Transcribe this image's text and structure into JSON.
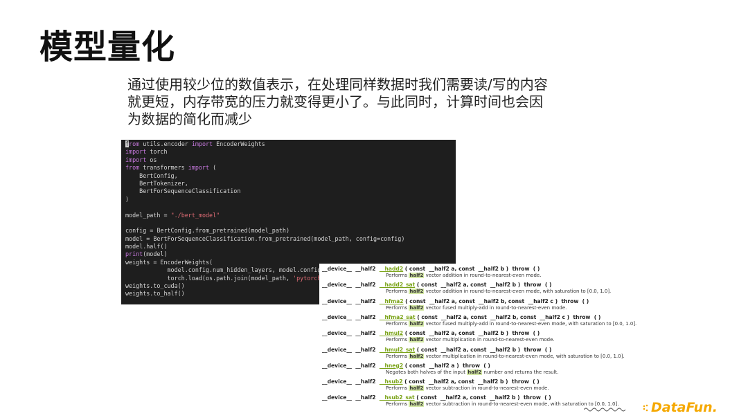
{
  "slide": {
    "title": "模型量化",
    "description_lines": [
      "通过使用较少位的数值表示，在处理同样数据时我们需要读/写的内容",
      "就更短，内存带宽的压力就变得更小了。与此同时，计算时间也会因",
      "为数据的简化而减少"
    ]
  },
  "code": [
    [
      [
        "cursor",
        "f"
      ],
      [
        "kw",
        "rom"
      ],
      [
        "t",
        " utils.encoder "
      ],
      [
        "kw",
        "import"
      ],
      [
        "t",
        " EncoderWeights"
      ]
    ],
    [
      [
        "kw",
        "import"
      ],
      [
        "t",
        " torch"
      ]
    ],
    [
      [
        "kw",
        "import"
      ],
      [
        "t",
        " os"
      ]
    ],
    [
      [
        "kw",
        "from"
      ],
      [
        "t",
        " transformers "
      ],
      [
        "kw",
        "import"
      ],
      [
        "t",
        " ("
      ]
    ],
    [
      [
        "t",
        "    BertConfig,"
      ]
    ],
    [
      [
        "t",
        "    BertTokenizer,"
      ]
    ],
    [
      [
        "t",
        "    BertForSequenceClassification"
      ]
    ],
    [
      [
        "t",
        ")"
      ]
    ],
    [
      [
        "t",
        ""
      ]
    ],
    [
      [
        "t",
        "model_path = "
      ],
      [
        "str",
        "\"./bert_model\""
      ]
    ],
    [
      [
        "t",
        ""
      ]
    ],
    [
      [
        "t",
        "config = BertConfig.from_pretrained(model_path)"
      ]
    ],
    [
      [
        "t",
        "model = BertForSequenceClassification.from_pretrained(model_path, config=config)"
      ]
    ],
    [
      [
        "t",
        "model.half()"
      ]
    ],
    [
      [
        "fn",
        "print"
      ],
      [
        "t",
        "(model)"
      ]
    ],
    [
      [
        "t",
        "weights = EncoderWeights("
      ]
    ],
    [
      [
        "t",
        "            model.config.num_hidden_layers, model.config.hid"
      ]
    ],
    [
      [
        "t",
        "            torch.load(os.path.join(model_path, "
      ],
      [
        "str",
        "'pytorch_mod"
      ]
    ],
    [
      [
        "t",
        "weights.to_cuda()"
      ]
    ],
    [
      [
        "t",
        "weights.to_half()"
      ]
    ]
  ],
  "docs": [
    {
      "prefix": "__device__  __half2  ",
      "fname": "__hadd2",
      "args": " ( const  __half2 a, const  __half2 b )  throw  ( )",
      "desc_pre": "Performs ",
      "desc_hl": "half2",
      "desc_post": " vector addition in round-to-nearest-even mode."
    },
    {
      "prefix": "__device__  __half2  ",
      "fname": "__hadd2_sat",
      "args": " ( const  __half2 a, const  __half2 b )  throw  ( )",
      "desc_pre": "Performs ",
      "desc_hl": "half2",
      "desc_post": " vector addition in round-to-nearest-even mode, with saturation to [0.0, 1.0]."
    },
    {
      "prefix": "__device__  __half2  ",
      "fname": "__hfma2",
      "args": " ( const  __half2 a, const  __half2 b, const  __half2 c )  throw  ( )",
      "desc_pre": "Performs ",
      "desc_hl": "half2",
      "desc_post": " vector fused multiply-add in round-to-nearest-even mode."
    },
    {
      "prefix": "__device__  __half2  ",
      "fname": "__hfma2_sat",
      "args": " ( const  __half2 a, const  __half2 b, const  __half2 c )  throw  ( )",
      "desc_pre": "Performs ",
      "desc_hl": "half2",
      "desc_post": " vector fused multiply-add in round-to-nearest-even mode, with saturation to [0.0, 1.0]."
    },
    {
      "prefix": "__device__  __half2  ",
      "fname": "__hmul2",
      "args": " ( const  __half2 a, const  __half2 b )  throw  ( )",
      "desc_pre": "Performs ",
      "desc_hl": "half2",
      "desc_post": " vector multiplication in round-to-nearest-even mode."
    },
    {
      "prefix": "__device__  __half2  ",
      "fname": "__hmul2_sat",
      "args": " ( const  __half2 a, const  __half2 b )  throw  ( )",
      "desc_pre": "Performs ",
      "desc_hl": "half2",
      "desc_post": " vector multiplication in round-to-nearest-even mode, with saturation to [0.0, 1.0]."
    },
    {
      "prefix": "__device__  __half2  ",
      "fname": "__hneg2",
      "args": " ( const  __half2 a )  throw  ( )",
      "desc_pre": "Negates both halves of the input ",
      "desc_hl": "half2",
      "desc_post": " number and returns the result."
    },
    {
      "prefix": "__device__  __half2  ",
      "fname": "__hsub2",
      "args": " ( const  __half2 a, const  __half2 b )  throw  ( )",
      "desc_pre": "Performs ",
      "desc_hl": "half2",
      "desc_post": " vector subtraction in round-to-nearest-even mode."
    },
    {
      "prefix": "__device__  __half2  ",
      "fname": "__hsub2_sat",
      "args": " ( const  __half2 a, const  __half2 b )  throw  ( )",
      "desc_pre": "Performs ",
      "desc_hl": "half2",
      "desc_post": " vector subtraction in round-to-nearest-even mode, with saturation to [0.0, 1.0]."
    }
  ],
  "logo": {
    "text": "DataFun.",
    "icon": "datafun-logo-icon",
    "color": "#f5a800"
  }
}
